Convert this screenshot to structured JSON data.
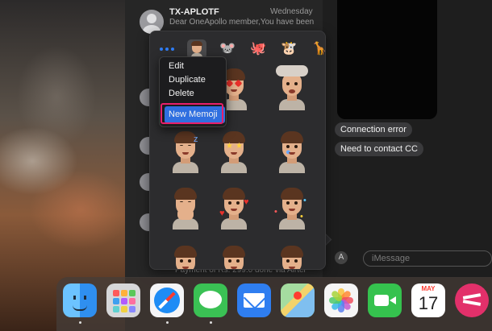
{
  "conversation": {
    "name": "TX-APLOTF",
    "date": "Wednesday",
    "preview": "Dear OneApollo member,You have been",
    "bottom_preview": "Payment of Rs. 299.0 done via Airtel"
  },
  "chat": {
    "messages": [
      "Connection error",
      "Need to contact CC"
    ],
    "input_placeholder": "iMessage"
  },
  "memoji_picker": {
    "categories": [
      {
        "name": "more",
        "glyph": ""
      },
      {
        "name": "memoji-self",
        "glyph": ""
      },
      {
        "name": "mouse",
        "glyph": "🐭"
      },
      {
        "name": "octopus",
        "glyph": "🐙"
      },
      {
        "name": "cow",
        "glyph": "🐮"
      },
      {
        "name": "giraffe",
        "glyph": "🦒"
      }
    ],
    "stickers": [
      {
        "name": "heart-eyes",
        "variant": "hearts"
      },
      {
        "name": "exploding-head",
        "variant": "cloud"
      },
      {
        "name": "sleeping",
        "variant": "zzz"
      },
      {
        "name": "star-struck",
        "variant": "stars"
      },
      {
        "name": "crying",
        "variant": "tear"
      },
      {
        "name": "praying",
        "variant": "hands"
      },
      {
        "name": "hearts-around",
        "variant": "hearts-around"
      },
      {
        "name": "party",
        "variant": "confetti"
      },
      {
        "name": "angry",
        "variant": "plain"
      },
      {
        "name": "neutral",
        "variant": "plain"
      },
      {
        "name": "sweat",
        "variant": "plain"
      }
    ]
  },
  "context_menu": {
    "items": [
      "Edit",
      "Duplicate",
      "Delete"
    ],
    "highlighted": "New Memoji"
  },
  "dock": {
    "calendar_month": "MAY",
    "calendar_day": "17",
    "apps": [
      {
        "name": "finder",
        "color": "#3fa0f0"
      },
      {
        "name": "launchpad",
        "color": "#d7d7d9"
      },
      {
        "name": "safari",
        "color": "#f5f5f7"
      },
      {
        "name": "messages",
        "color": "#3ac154"
      },
      {
        "name": "mail",
        "color": "#2f7ef0"
      },
      {
        "name": "maps",
        "color": "#5fbf5a"
      },
      {
        "name": "photos",
        "color": "#f5f5f5"
      },
      {
        "name": "facetime",
        "color": "#35c24e"
      },
      {
        "name": "calendar",
        "color": "#ffffff"
      },
      {
        "name": "skitch",
        "color": "#e2306a"
      }
    ]
  }
}
